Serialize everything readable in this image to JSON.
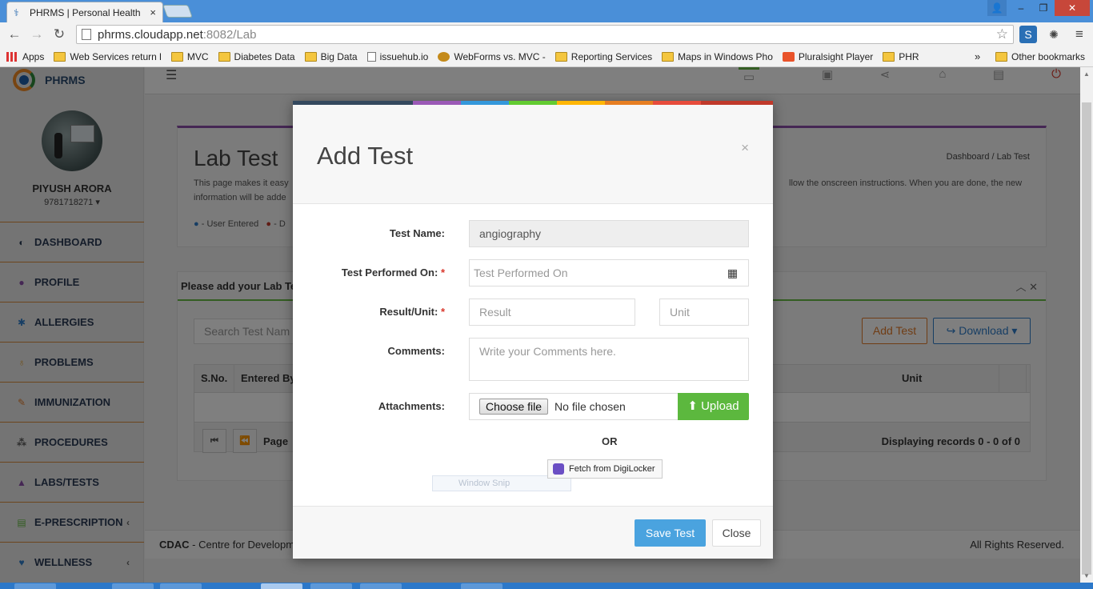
{
  "browser": {
    "tab_title": "PHRMS | Personal Health",
    "tab_close": "×",
    "url_host": "phrms.cloudapp.net",
    "url_path": ":8082/Lab",
    "window_user": "👤",
    "window_min": "–",
    "window_max": "❐",
    "window_close": "✕",
    "bookmarks": [
      {
        "label": "Apps",
        "icon": "apps-icon"
      },
      {
        "label": "Web Services return l",
        "icon": "folder-icon"
      },
      {
        "label": "MVC",
        "icon": "folder-icon"
      },
      {
        "label": "Diabetes Data",
        "icon": "folder-icon"
      },
      {
        "label": "Big Data",
        "icon": "folder-icon"
      },
      {
        "label": "issuehub.io",
        "icon": "page-icon"
      },
      {
        "label": "WebForms vs. MVC -",
        "icon": "web-icon"
      },
      {
        "label": "Reporting Services",
        "icon": "folder-icon"
      },
      {
        "label": "Maps in Windows Pho",
        "icon": "folder-icon"
      },
      {
        "label": "Pluralsight Player",
        "icon": "play-icon"
      },
      {
        "label": "PHR",
        "icon": "folder-icon"
      }
    ],
    "bookmarks_more": "»",
    "other_bookmarks": "Other bookmarks"
  },
  "sidebar": {
    "brand": "PHRMS",
    "user_name": "PIYUSH ARORA",
    "user_phone": "9781718271 ▾",
    "items": [
      {
        "label": "DASHBOARD",
        "icon": "dashboard-icon",
        "glyph": "◐",
        "color": "#2a3a55",
        "caret": ""
      },
      {
        "label": "PROFILE",
        "icon": "user-icon",
        "glyph": "●",
        "color": "#8a4fa8",
        "caret": ""
      },
      {
        "label": "ALLERGIES",
        "icon": "allergy-icon",
        "glyph": "✱",
        "color": "#2f7cc8",
        "caret": ""
      },
      {
        "label": "PROBLEMS",
        "icon": "stethoscope-icon",
        "glyph": "♁",
        "color": "#e0a030",
        "caret": ""
      },
      {
        "label": "IMMUNIZATION",
        "icon": "syringe-icon",
        "glyph": "✎",
        "color": "#e07b2a",
        "caret": ""
      },
      {
        "label": "PROCEDURES",
        "icon": "procedures-icon",
        "glyph": "⁂",
        "color": "#555",
        "caret": ""
      },
      {
        "label": "LABS/TESTS",
        "icon": "flask-icon",
        "glyph": "▲",
        "color": "#8a4fa8",
        "caret": ""
      },
      {
        "label": "E-PRESCRIPTION",
        "icon": "prescription-icon",
        "glyph": "▤",
        "color": "#66bb44",
        "caret": "‹"
      },
      {
        "label": "WELLNESS",
        "icon": "heart-icon",
        "glyph": "♥",
        "color": "#2f7cc8",
        "caret": "‹"
      }
    ]
  },
  "page": {
    "title": "Lab Test",
    "desc_left": "This page makes it easy",
    "desc_left2": "information will be adde",
    "desc_right": "llow the onscreen instructions. When you are done, the new",
    "legend_user": "- User Entered",
    "legend_other": "- D",
    "breadcrumb": "Dashboard  /  Lab Test",
    "list_title": "Please add your Lab Te",
    "search_placeholder": "Search Test Nam",
    "add_test": "Add Test",
    "download": "↪ Download ▾",
    "columns": [
      "S.No.",
      "Entered By",
      "Unit"
    ],
    "pager_label": "Page",
    "records": "Displaying records 0 - 0 of 0",
    "footer_left_bold": "CDAC",
    "footer_left": " - Centre for Developm",
    "footer_right": "All Rights Reserved."
  },
  "modal": {
    "title": "Add Test",
    "close": "×",
    "stripe_colors": [
      "#34495e",
      "#9b59b6",
      "#3498db",
      "#62cb31",
      "#ffb606",
      "#e67e22",
      "#e74c3c",
      "#c0392b"
    ],
    "test_name_label": "Test Name:",
    "test_name_value": "angiography",
    "performed_label": "Test Performed On:",
    "performed_placeholder": "Test Performed On",
    "result_label": "Result/Unit:",
    "result_placeholder": "Result",
    "unit_placeholder": "Unit",
    "comments_label": "Comments:",
    "comments_placeholder": "Write your Comments here.",
    "attachments_label": "Attachments:",
    "choose_file": "Choose file",
    "no_file": "No file chosen",
    "upload": "Upload",
    "or": "OR",
    "digilocker": "Fetch from DigiLocker",
    "window_snip": "Window Snip",
    "save": "Save Test",
    "close_btn": "Close",
    "required_mark": "*"
  }
}
